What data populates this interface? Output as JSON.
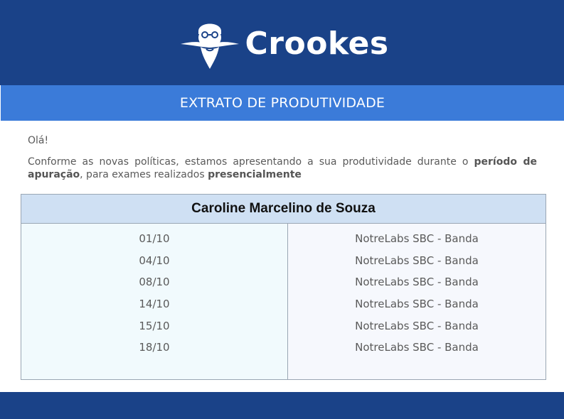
{
  "header": {
    "brand_name": "Crookes",
    "logo_icon": "professor-face-icon",
    "background_color": "#1a4288"
  },
  "title_bar": {
    "title": "EXTRATO DE PRODUTIVIDADE",
    "background_color": "#3b7bd9"
  },
  "message": {
    "greeting": "Olá!",
    "intro": "Conforme as novas políticas, estamos apresentando a sua produtividade durante o ",
    "highlight_period": "período de apuração",
    "middle": ", para exames realizados ",
    "highlight_mode": "presencialmente"
  },
  "table": {
    "header": "Caroline Marcelino de Souza",
    "header_color": "#cfe0f3",
    "rows": [
      {
        "date": "01/10",
        "location": "NotreLabs SBC - Banda"
      },
      {
        "date": "04/10",
        "location": "NotreLabs SBC - Banda"
      },
      {
        "date": "08/10",
        "location": "NotreLabs SBC - Banda"
      },
      {
        "date": "14/10",
        "location": "NotreLabs SBC - Banda"
      },
      {
        "date": "15/10",
        "location": "NotreLabs SBC - Banda"
      },
      {
        "date": "18/10",
        "location": "NotreLabs SBC - Banda"
      }
    ]
  },
  "footer": {
    "background_color": "#1a4288"
  }
}
